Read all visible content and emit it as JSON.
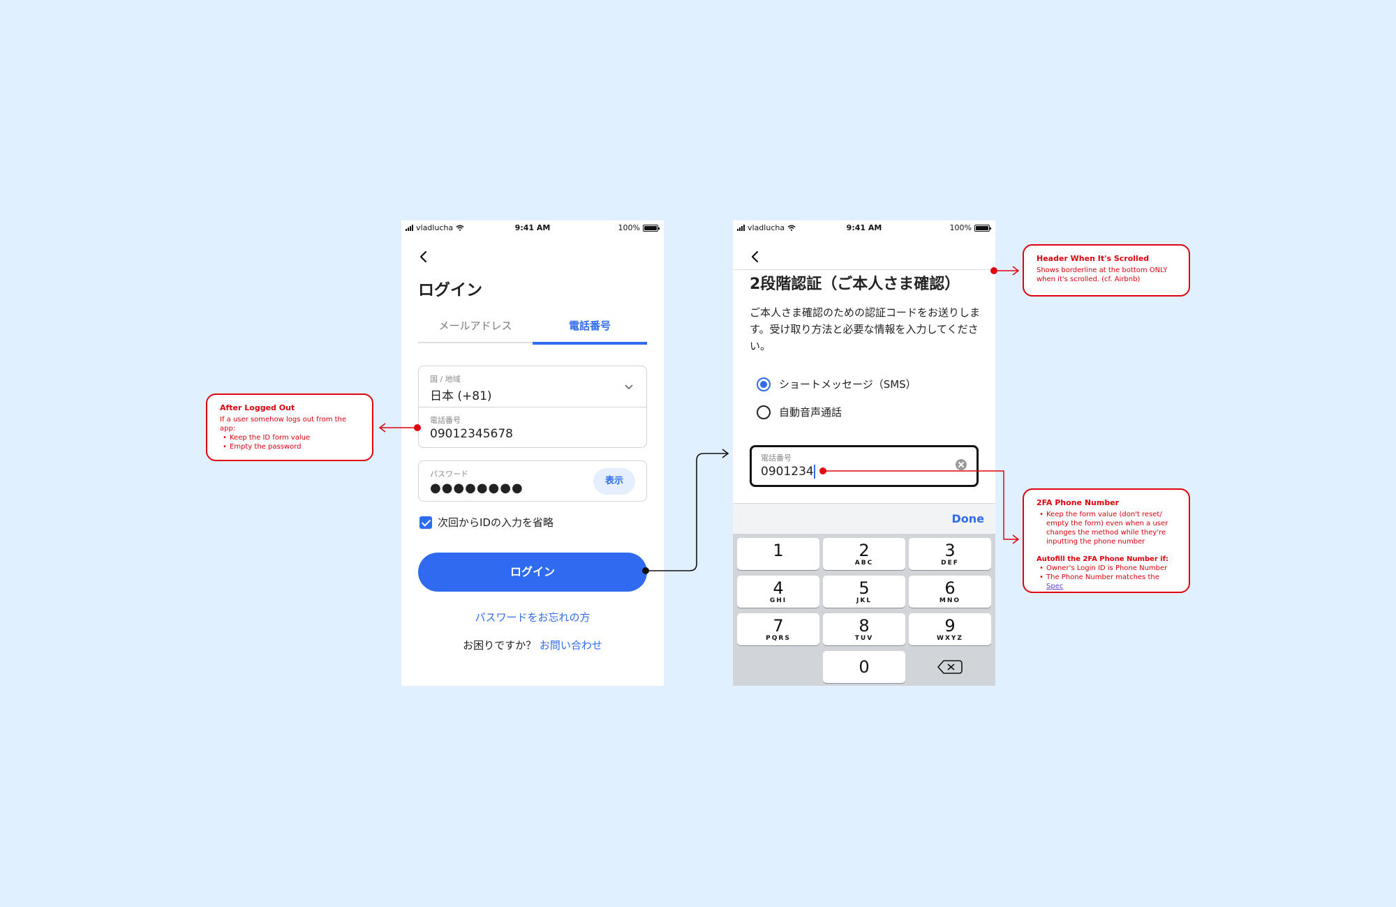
{
  "status_bar": {
    "carrier": "vladlucha",
    "time": "9:41 AM",
    "battery": "100%"
  },
  "login_screen": {
    "title": "ログイン",
    "tabs": [
      "メールアドレス",
      "電話番号"
    ],
    "active_tab": "電話番号",
    "country_label": "国 / 地域",
    "country_value": "日本 (+81)",
    "phone_label": "電話番号",
    "phone_value": "09012345678",
    "password_label": "パスワード",
    "password_value": "●●●●●●●●",
    "show_button_label": "表示",
    "remember_label": "次回からIDの入力を省略",
    "remember_checked": true,
    "login_button_label": "ログイン",
    "forgot_password_link": "パスワードをお忘れの方",
    "help_text": "お困りですか？",
    "contact_link": "お問い合わせ"
  },
  "twofa_screen": {
    "title": "2段階認証（ご本人さま確認）",
    "description": "ご本人さま確認のための認証コードをお送りします。受け取り方法と必要な情報を入力してください。",
    "methods": [
      {
        "label": "ショートメッセージ（SMS）",
        "selected": true
      },
      {
        "label": "自動音声通話",
        "selected": false
      }
    ],
    "phone_label": "電話番号",
    "phone_value": "0901234",
    "done_label": "Done",
    "keys": [
      {
        "num": "1",
        "letters": ""
      },
      {
        "num": "2",
        "letters": "ABC"
      },
      {
        "num": "3",
        "letters": "DEF"
      },
      {
        "num": "4",
        "letters": "GHI"
      },
      {
        "num": "5",
        "letters": "JKL"
      },
      {
        "num": "6",
        "letters": "MNO"
      },
      {
        "num": "7",
        "letters": "PQRS"
      },
      {
        "num": "8",
        "letters": "TUV"
      },
      {
        "num": "9",
        "letters": "WXYZ"
      },
      {
        "num": "0",
        "letters": ""
      }
    ]
  },
  "annotations": {
    "after_logout": {
      "title": "After Logged Out",
      "intro": "If a user somehow logs out from the app:",
      "items": [
        "Keep the ID form value",
        "Empty the password"
      ]
    },
    "header_scrolled": {
      "title": "Header When It's Scrolled",
      "body": "Shows borderline at the bottom ONLY when it's scrolled. (cf. Airbnb)"
    },
    "twofa_phone": {
      "title": "2FA Phone Number",
      "items": [
        "Keep the form value (don't reset/ empty the form) even when a user changes the method while they're inputting the phone number"
      ],
      "autofill_title": "Autofill the 2FA Phone Number if:",
      "autofill_items": [
        "Owner's Login ID is Phone Number",
        "The Phone Number matches the"
      ],
      "spec_link": "Spec"
    }
  },
  "colors": {
    "background": "#e1f0fe",
    "accent": "#2f6bf0",
    "annotation": "#e0000e"
  }
}
